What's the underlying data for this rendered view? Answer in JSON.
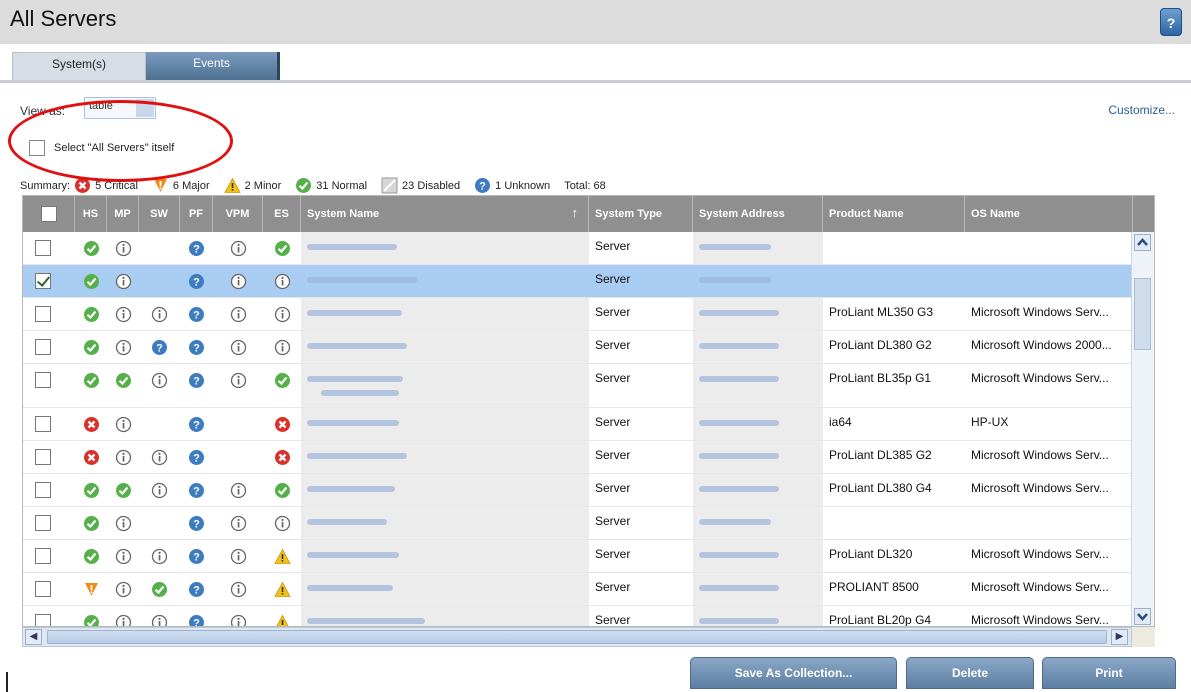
{
  "page": {
    "title": "All Servers",
    "help_label": "?"
  },
  "tabs": [
    {
      "label": "System(s)",
      "active": true
    },
    {
      "label": "Events",
      "active": false
    }
  ],
  "view_as": {
    "label": "View as:",
    "value": "table"
  },
  "customize_label": "Customize...",
  "select_itself_label": "Select \"All Servers\" itself",
  "annotation": {
    "shape": "ellipse",
    "color": "#e01010"
  },
  "summary": {
    "label": "Summary:",
    "critical": "5 Critical",
    "major": "6 Major",
    "minor": "2 Minor",
    "normal": "31 Normal",
    "disabled": "23 Disabled",
    "unknown": "1 Unknown",
    "total": "Total: 68"
  },
  "columns": [
    "HS",
    "MP",
    "SW",
    "PF",
    "VPM",
    "ES",
    "System Name",
    "System Type",
    "System Address",
    "Product Name",
    "OS Name"
  ],
  "rows": [
    {
      "checked": false,
      "selected": false,
      "hs": "normal",
      "mp": "info",
      "sw": "",
      "pf": "unknown",
      "vpm": "info",
      "es": "normal",
      "type": "Server",
      "product": "",
      "os": ""
    },
    {
      "checked": true,
      "selected": true,
      "hs": "normal",
      "mp": "info",
      "sw": "",
      "pf": "unknown",
      "vpm": "info",
      "es": "info",
      "type": "Server",
      "product": "",
      "os": ""
    },
    {
      "checked": false,
      "selected": false,
      "hs": "normal",
      "mp": "info",
      "sw": "info",
      "pf": "unknown",
      "vpm": "info",
      "es": "info",
      "type": "Server",
      "product": "ProLiant ML350 G3",
      "os": "Microsoft Windows Serv..."
    },
    {
      "checked": false,
      "selected": false,
      "hs": "normal",
      "mp": "info",
      "sw": "unknown",
      "pf": "unknown",
      "vpm": "info",
      "es": "info",
      "type": "Server",
      "product": "ProLiant DL380 G2",
      "os": "Microsoft Windows 2000..."
    },
    {
      "checked": false,
      "selected": false,
      "hs": "normal",
      "mp": "normal",
      "sw": "info",
      "pf": "unknown",
      "vpm": "info",
      "es": "normal",
      "type": "Server",
      "product": "ProLiant BL35p G1",
      "os": "Microsoft Windows Serv...",
      "tall": true
    },
    {
      "checked": false,
      "selected": false,
      "hs": "critical",
      "mp": "info",
      "sw": "",
      "pf": "unknown",
      "vpm": "",
      "es": "critical",
      "type": "Server",
      "product": "ia64",
      "os": "HP-UX"
    },
    {
      "checked": false,
      "selected": false,
      "hs": "critical",
      "mp": "info",
      "sw": "info",
      "pf": "unknown",
      "vpm": "",
      "es": "critical",
      "type": "Server",
      "product": "ProLiant DL385 G2",
      "os": "Microsoft Windows Serv..."
    },
    {
      "checked": false,
      "selected": false,
      "hs": "normal",
      "mp": "normal",
      "sw": "info",
      "pf": "unknown",
      "vpm": "info",
      "es": "normal",
      "type": "Server",
      "product": "ProLiant DL380 G4",
      "os": "Microsoft Windows Serv..."
    },
    {
      "checked": false,
      "selected": false,
      "hs": "normal",
      "mp": "info",
      "sw": "",
      "pf": "unknown",
      "vpm": "info",
      "es": "info",
      "type": "Server",
      "product": "",
      "os": ""
    },
    {
      "checked": false,
      "selected": false,
      "hs": "normal",
      "mp": "info",
      "sw": "info",
      "pf": "unknown",
      "vpm": "info",
      "es": "minor",
      "type": "Server",
      "product": "ProLiant DL320",
      "os": "Microsoft Windows Serv..."
    },
    {
      "checked": false,
      "selected": false,
      "hs": "major",
      "mp": "info",
      "sw": "normal",
      "pf": "unknown",
      "vpm": "info",
      "es": "minor",
      "type": "Server",
      "product": "PROLIANT 8500",
      "os": "Microsoft Windows Serv..."
    },
    {
      "checked": false,
      "selected": false,
      "hs": "normal",
      "mp": "info",
      "sw": "info",
      "pf": "unknown",
      "vpm": "info",
      "es": "minor",
      "type": "Server",
      "product": "ProLiant BL20p G4",
      "os": "Microsoft Windows Serv..."
    }
  ],
  "buttons": {
    "save": "Save As Collection...",
    "delete": "Delete",
    "print": "Print"
  },
  "status_colors": {
    "normal": "#55b04a",
    "critical": "#d9302a",
    "major": "#f08a1a",
    "minor": "#f2c21b",
    "unknown": "#3d7cc0",
    "info": "#666666",
    "header": "#8f8f8f",
    "selected_row": "#a8ccf2"
  }
}
